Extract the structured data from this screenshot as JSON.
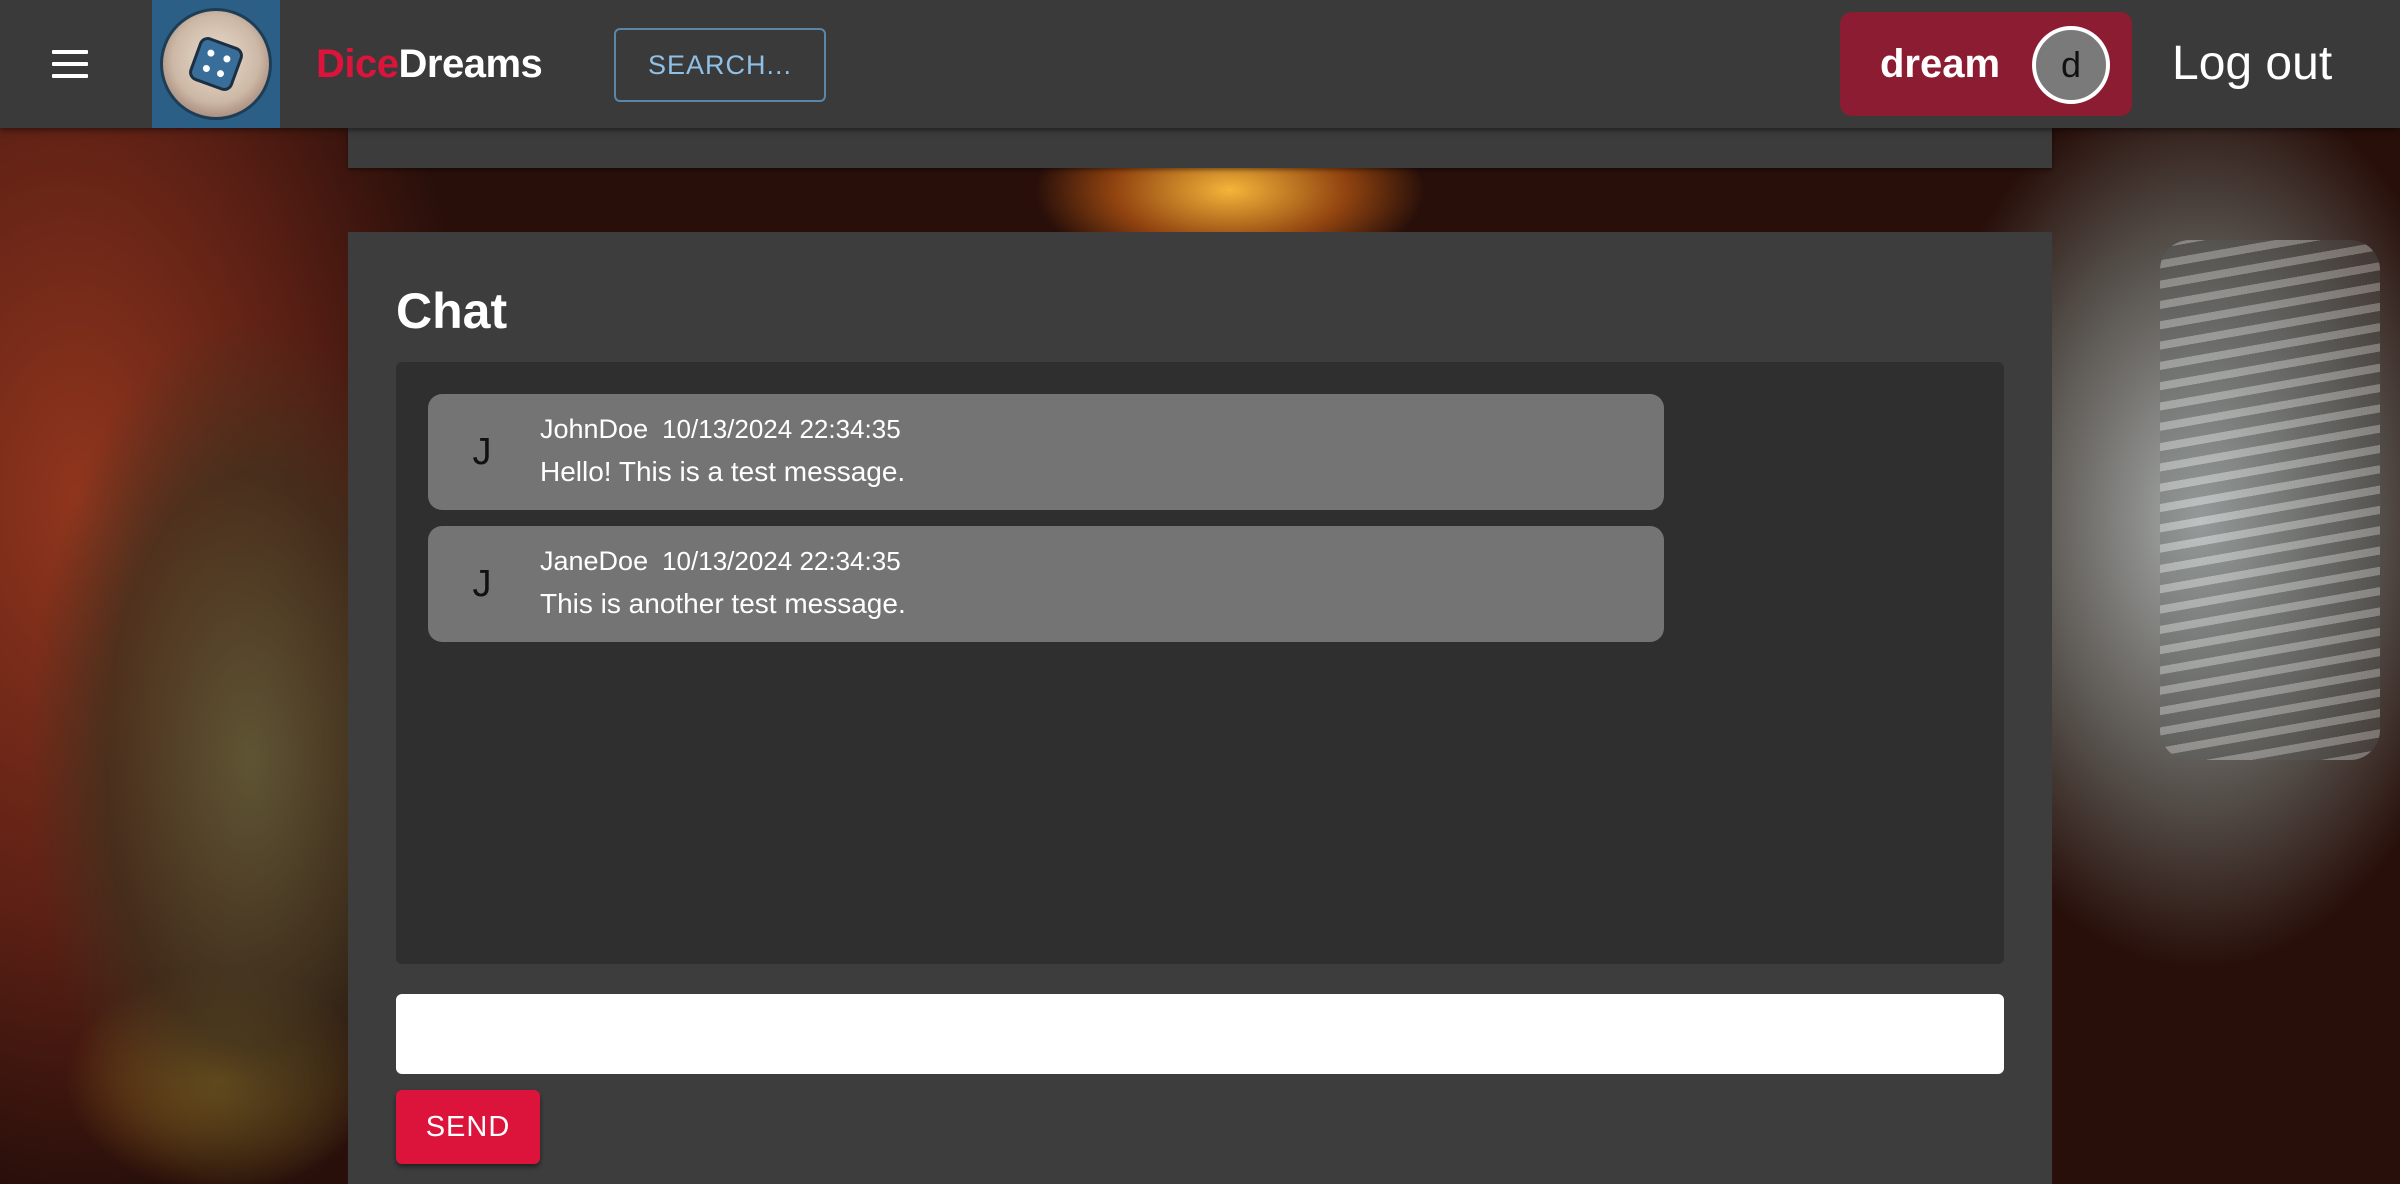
{
  "brand": {
    "part1": "Dice",
    "part2": "Dreams"
  },
  "header": {
    "search_label": "SEARCH...",
    "username": "dream",
    "avatar_initial": "d",
    "logout_label": "Log out"
  },
  "chat": {
    "title": "Chat",
    "messages": [
      {
        "initial": "J",
        "author": "JohnDoe",
        "timestamp": "10/13/2024 22:34:35",
        "text": "Hello! This is a test message."
      },
      {
        "initial": "J",
        "author": "JaneDoe",
        "timestamp": "10/13/2024 22:34:35",
        "text": "This is another test message."
      }
    ],
    "input_value": "",
    "send_label": "SEND"
  },
  "colors": {
    "brand_accent": "#dc143c",
    "user_chip": "#8c1c31",
    "appbar": "#3a3a3a",
    "panel": "#3d3d3d",
    "message_bg": "#747474"
  },
  "icons": {
    "menu": "hamburger-menu-icon",
    "logo": "dice-logo"
  }
}
